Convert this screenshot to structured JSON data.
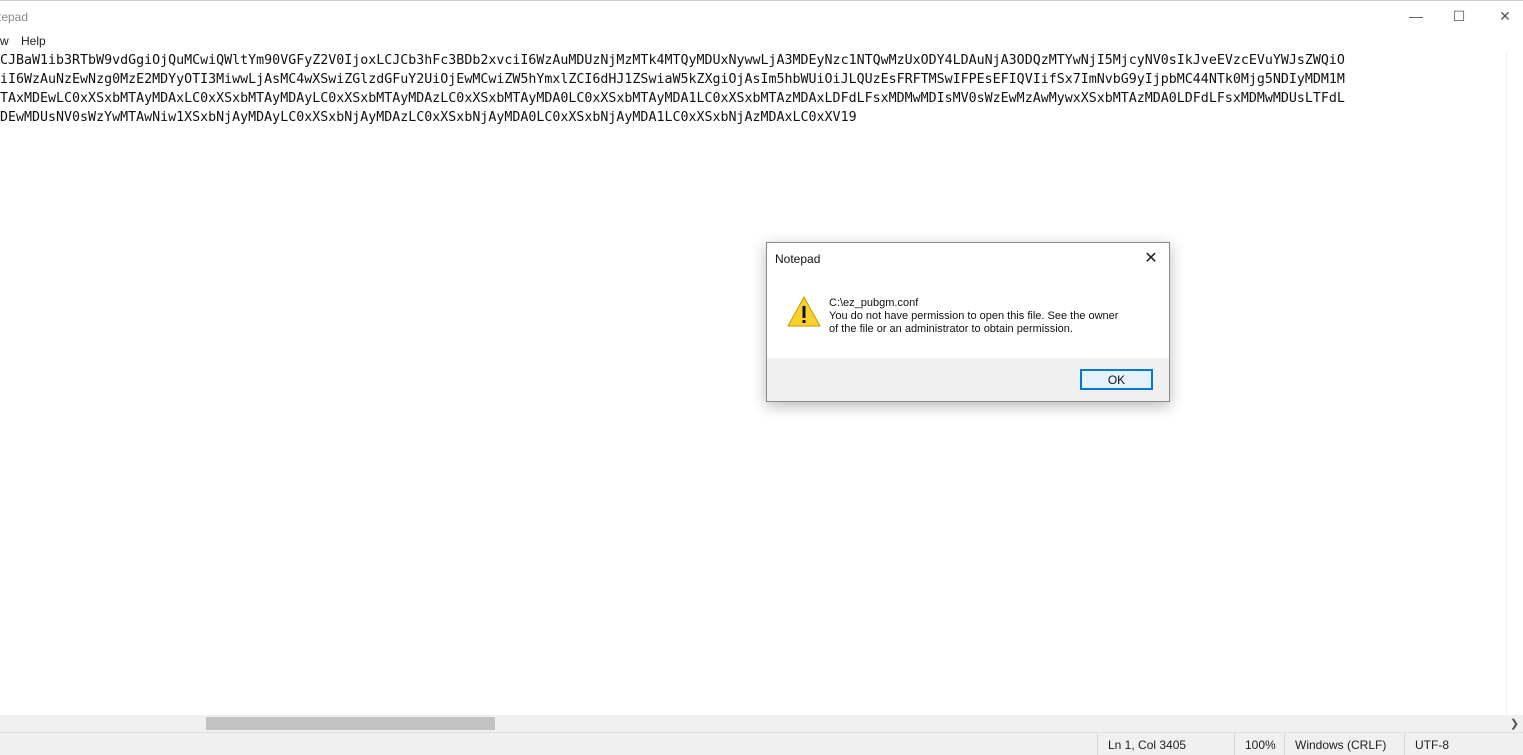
{
  "window": {
    "title": "tepad",
    "minimize_glyph": "—",
    "maximize_glyph": "☐",
    "close_glyph": "✕"
  },
  "menu": {
    "items": [
      "w",
      "Help"
    ]
  },
  "editor": {
    "lines": [
      "CJBaW1ib3RTbW9vdGgiOjQuMCwiQWltYm90VGFyZ2V0IjoxLCJCb3hFc3BDb2xvciI6WzAuMDUzNjMzMTk4MTQyMDUxNywwLjA3MDEyNzc1NTQwMzUxODY4LDAuNjA3ODQzMTYwNjI5MjcyNV0sIkJveEVzcEVuYWJsZWQiO",
      "iI6WzAuNzEwNzg0MzE2MDYyOTI3MiwwLjAsMC4wXSwiZGlzdGFuY2UiOjEwMCwiZW5hYmxlZCI6dHJ1ZSwiaW5kZXgiOjAsIm5hbWUiOiJLQUzEsFRFTMSwIFPEsEFIQVIifSx7ImNvbG9yIjpbMC44NTk0Mjg5NDIyMDM1M",
      "TAxMDEwLC0xXSxbMTAyMDAxLC0xXSxbMTAyMDAyLC0xXSxbMTAyMDAzLC0xXSxbMTAyMDA0LC0xXSxbMTAyMDA1LC0xXSxbMTAzMDAxLDFdLFsxMDMwMDIsMV0sWzEwMzAwMywxXSxbMTAzMDA0LDFdLFsxMDMwMDUsLTFdL",
      "DEwMDUsNV0sWzYwMTAwNiw1XSxbNjAyMDAyLC0xXSxbNjAyMDAzLC0xXSxbNjAyMDA0LC0xXSxbNjAyMDA1LC0xXSxbNjAzMDAxLC0xXV19"
    ]
  },
  "statusbar": {
    "position": "Ln 1, Col 3405",
    "zoom": "100%",
    "line_ending": "Windows (CRLF)",
    "encoding": "UTF-8"
  },
  "dialog": {
    "title": "Notepad",
    "close_glyph": "✕",
    "path": "C:\\ez_pubgm.conf",
    "message_line1": "You do not have permission to open this file. See the owner",
    "message_line2": "of the file or an administrator to obtain permission.",
    "ok_label": "OK",
    "icon": "warning-icon"
  },
  "scrollbar": {
    "right_arrow_glyph": "❯"
  }
}
